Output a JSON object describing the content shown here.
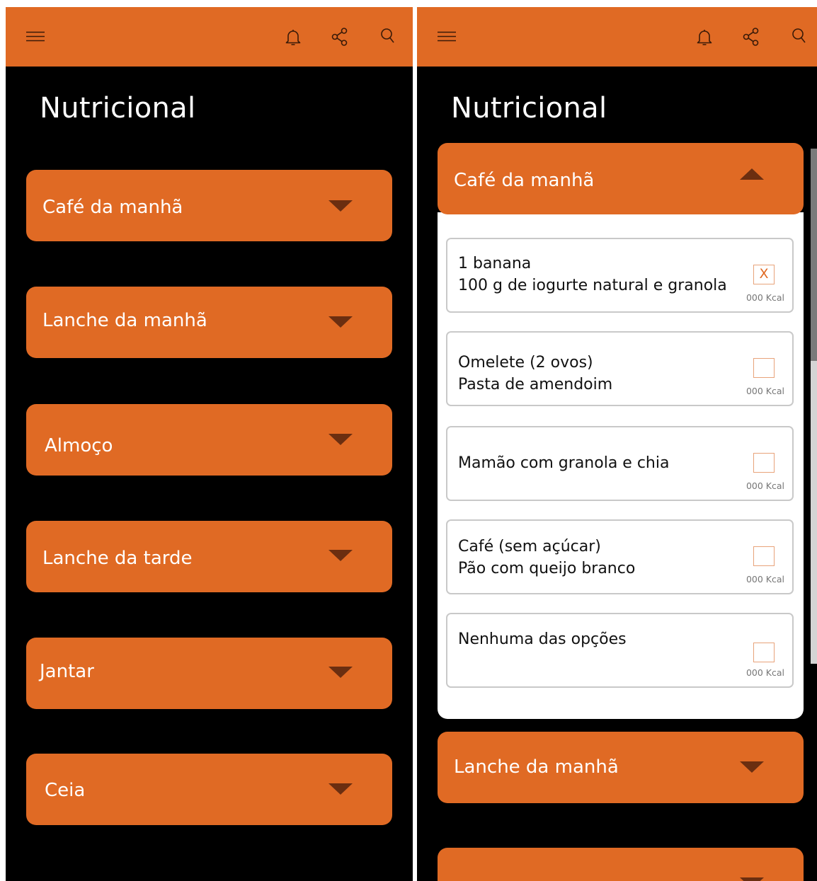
{
  "title": "Nutricional",
  "colors": {
    "accent": "#e06a24",
    "caret": "#6b2e10",
    "background": "#000000",
    "panel": "#ffffff"
  },
  "header_icons": [
    "menu-icon",
    "bell-icon",
    "share-icon",
    "search-icon"
  ],
  "meals": [
    {
      "label": "Café da manhã",
      "expanded": false
    },
    {
      "label": "Lanche da manhã",
      "expanded": false
    },
    {
      "label": "Almoço",
      "expanded": false
    },
    {
      "label": "Lanche da tarde",
      "expanded": false
    },
    {
      "label": "Jantar",
      "expanded": false
    },
    {
      "label": "Ceia",
      "expanded": false
    }
  ],
  "expanded_meal": {
    "label": "Café da manhã",
    "options": [
      {
        "line1": "1 banana",
        "line2": "100 g de iogurte natural e granola",
        "kcal": "000 Kcal",
        "checked": true,
        "check_mark": "X"
      },
      {
        "line1": "Omelete (2 ovos)",
        "line2": "Pasta de amendoim",
        "kcal": "000 Kcal",
        "checked": false,
        "check_mark": ""
      },
      {
        "line1": "Mamão com granola e chia",
        "line2": "",
        "kcal": "000 Kcal",
        "checked": false,
        "check_mark": ""
      },
      {
        "line1": "Café (sem açúcar)",
        "line2": "Pão com queijo branco",
        "kcal": "000 Kcal",
        "checked": false,
        "check_mark": ""
      },
      {
        "line1": "Nenhuma das opções",
        "line2": "",
        "kcal": "000 Kcal",
        "checked": false,
        "check_mark": ""
      }
    ]
  },
  "collapsed_after": [
    {
      "label": "Lanche da manhã"
    },
    {
      "label": ""
    }
  ]
}
